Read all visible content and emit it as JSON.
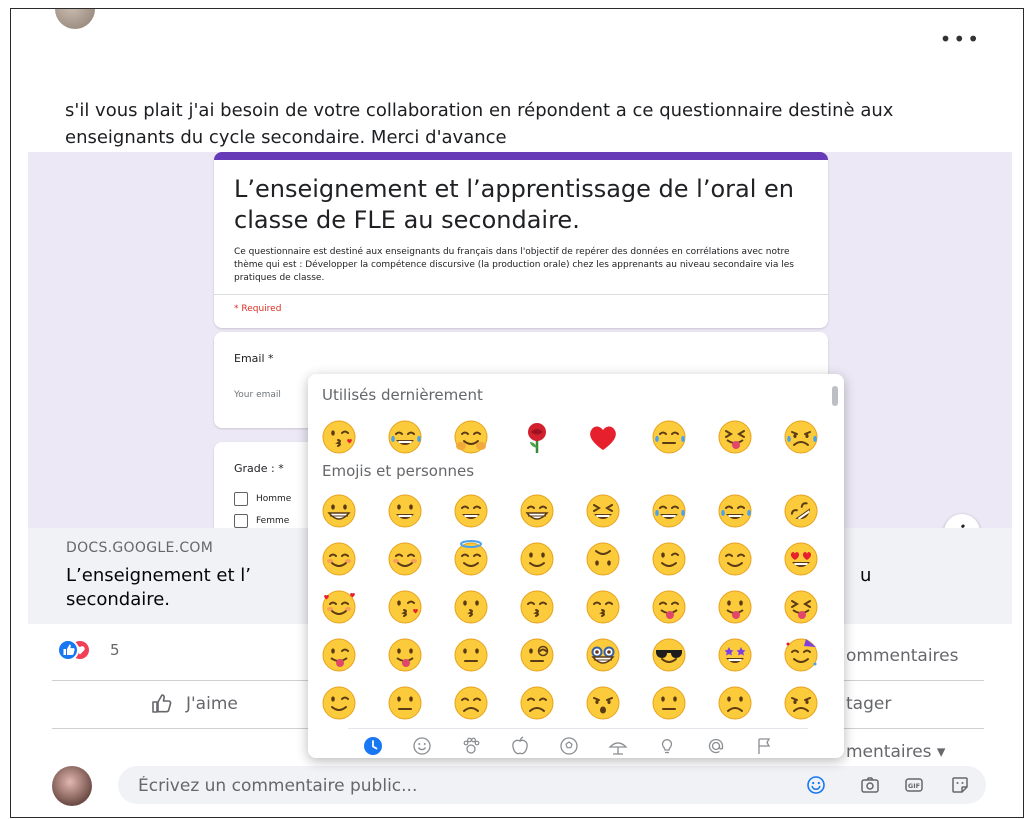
{
  "post": {
    "more_label": "•••",
    "text": "s'il vous plait j'ai besoin de votre collaboration en répondent a ce questionnaire destinè aux enseignants du cycle secondaire. Merci d'avance"
  },
  "form": {
    "title": "L’enseignement et l’apprentissage de l’oral en classe de FLE au secondaire.",
    "description": "Ce questionnaire est destiné aux enseignants du français dans l'objectif de repérer des données en corrélations avec notre thème qui est : Développer la compétence discursive (la production orale) chez les apprenants au niveau secondaire via les pratiques de classe.",
    "required": "* Required",
    "email_label": "Email *",
    "email_placeholder": "Your email",
    "grade_label": "Grade : *",
    "grade_options": [
      "Homme",
      "Femme"
    ]
  },
  "info_label": "i",
  "link": {
    "domain": "DOCS.GOOGLE.COM",
    "title_left": "L’enseignement et l’",
    "title_right": "u",
    "title_line2": "secondaire."
  },
  "reactions": {
    "count": "5",
    "like_color": "#1877f2",
    "love_color": "#f33e58"
  },
  "comments_count": "ommentaires",
  "actions": {
    "like": "J'aime",
    "share": "tager"
  },
  "most_relevant": "mentaires ▾",
  "comment": {
    "placeholder": "Écrivez un commentaire public..."
  },
  "emoji_picker": {
    "recent_label": "Utilisés dernièrement",
    "people_label": "Emojis et personnes",
    "recent": [
      "kissing-heart-face",
      "joy-face",
      "hugging-face",
      "rose",
      "heart",
      "sleepy-face",
      "squint-tongue-face",
      "crying-face"
    ],
    "people_rows": [
      [
        "grinning-face",
        "smiley-face",
        "smile-face",
        "grin-face",
        "laughing-face",
        "sweat-smile-face",
        "joy-face",
        "rofl-face"
      ],
      [
        "relaxed-face",
        "blush-face",
        "innocent-face",
        "slight-smile-face",
        "upside-down-face",
        "wink-face",
        "relieved-face",
        "heart-eyes-face"
      ],
      [
        "smiling-hearts-face",
        "kissing-heart-face",
        "kissing-face",
        "kissing-smile-face",
        "kissing-closed-eyes-face",
        "yum-face",
        "tongue-face",
        "squint-tongue-face"
      ],
      [
        "zany-face",
        "goofy-face",
        "raised-eyebrow-face",
        "monocle-face",
        "nerd-face",
        "sunglasses-face",
        "star-struck-face",
        "partying-face"
      ],
      [
        "smirk-face",
        "unamused-face",
        "disappointed-face",
        "pensive-face",
        "worried-face",
        "confused-face",
        "slight-frown-face",
        "frowning-face"
      ]
    ],
    "tabs": [
      "recent-clock",
      "smileys",
      "animals-nature",
      "food",
      "activities",
      "travel",
      "objects",
      "symbols",
      "flags"
    ],
    "accent": "#1877f2"
  }
}
